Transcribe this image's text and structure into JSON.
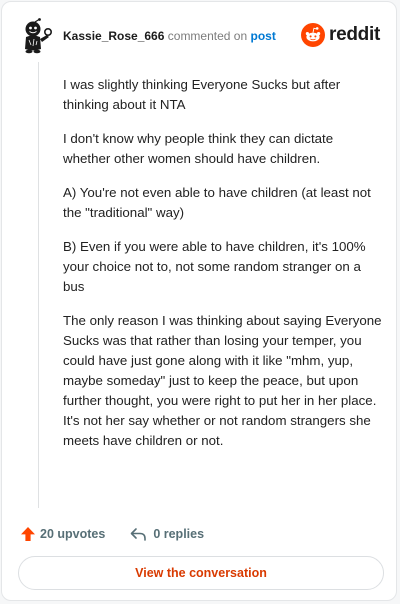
{
  "comment": {
    "username": "Kassie_Rose_666",
    "action_text": "commented on",
    "post_link_label": "post",
    "avatar_icon": "snoo-avatar-icon",
    "paragraphs": [
      "I was slightly thinking Everyone Sucks but after thinking about it NTA",
      "I don't know why people think they can dictate whether other women should have children.",
      "A) You're not even able to have children (at least not the \"traditional\" way)",
      "B) Even if you were able to have children, it's 100% your choice not to, not some random stranger on a bus",
      "The only reason I was thinking about saying Everyone Sucks was that rather than losing your temper, you could have just gone along with it like \"mhm, yup, maybe someday\" just to keep the peace, but upon further thought, you were right to put her in her place. It's not her say whether or not random strangers she meets have children or not."
    ]
  },
  "brand": {
    "name": "reddit",
    "logo_icon": "reddit-snoo-icon",
    "color": "#ff4500"
  },
  "stats": {
    "upvotes_label": "20 upvotes",
    "upvote_icon": "upvote-arrow-icon",
    "upvote_color": "#ff4500",
    "replies_label": "0 replies",
    "reply_icon": "reply-arrow-icon"
  },
  "footer": {
    "view_conversation_label": "View the conversation",
    "link_color": "#d93a00"
  }
}
